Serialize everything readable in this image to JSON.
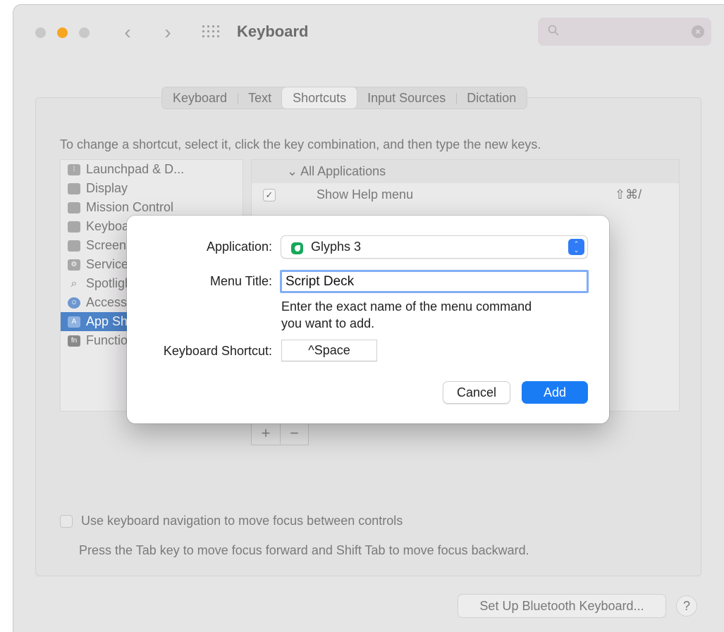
{
  "window": {
    "title": "Keyboard",
    "search_placeholder": ""
  },
  "tabs": [
    {
      "label": "Keyboard",
      "active": false
    },
    {
      "label": "Text",
      "active": false
    },
    {
      "label": "Shortcuts",
      "active": true
    },
    {
      "label": "Input Sources",
      "active": false
    },
    {
      "label": "Dictation",
      "active": false
    }
  ],
  "instructions": "To change a shortcut, select it, click the key combination, and then type the new keys.",
  "categories": [
    {
      "label": "Launchpad & D...",
      "icon": "launchpad-icon"
    },
    {
      "label": "Display",
      "icon": "display-icon"
    },
    {
      "label": "Mission Control",
      "icon": "mission-control-icon"
    },
    {
      "label": "Keyboard",
      "icon": "keyboard-icon"
    },
    {
      "label": "Screenshots",
      "icon": "screenshot-icon"
    },
    {
      "label": "Services",
      "icon": "gear-icon"
    },
    {
      "label": "Spotlight",
      "icon": "search-icon"
    },
    {
      "label": "Accessibility",
      "icon": "accessibility-icon"
    },
    {
      "label": "App Shortcuts",
      "icon": "app-store-icon"
    },
    {
      "label": "Function Keys",
      "icon": "fn-icon"
    }
  ],
  "shortcuts_pane": {
    "group_label": "All Applications",
    "rows": [
      {
        "label": "Show Help menu",
        "keys": "⇧⌘/",
        "checked": true
      }
    ]
  },
  "list_buttons": {
    "add": "+",
    "remove": "−"
  },
  "keyboard_navigation": {
    "label": "Use keyboard navigation to move focus between controls",
    "description": "Press the Tab key to move focus forward and Shift Tab to move focus backward.",
    "checked": false
  },
  "bluetooth_button": "Set Up Bluetooth Keyboard...",
  "help_button": "?",
  "sheet": {
    "application_label": "Application:",
    "application_value": "Glyphs 3",
    "menu_title_label": "Menu Title:",
    "menu_title_value": "Script Deck",
    "hint": "Enter the exact name of the menu command you want to add.",
    "shortcut_label": "Keyboard Shortcut:",
    "shortcut_value": "^Space",
    "cancel_label": "Cancel",
    "add_label": "Add"
  },
  "colors": {
    "accent": "#1a7cf5",
    "selection": "#4c83c9",
    "app_icon": "#16a85b",
    "minimize_light": "#f6a623"
  }
}
